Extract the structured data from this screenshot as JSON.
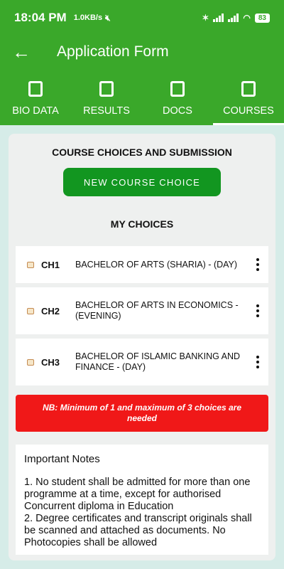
{
  "status_bar": {
    "time": "18:04 PM",
    "speed": "1.0KB/s",
    "battery": "83"
  },
  "app_bar": {
    "title": "Application Form"
  },
  "tabs": [
    {
      "label": "BIO DATA",
      "icon": "person-icon",
      "active": false
    },
    {
      "label": "RESULTS",
      "icon": "list-icon",
      "active": false
    },
    {
      "label": "DOCS",
      "icon": "clipboard-icon",
      "active": false
    },
    {
      "label": "COURSES",
      "icon": "checkbox-icon",
      "active": true
    }
  ],
  "main": {
    "section_title": "COURSE CHOICES AND SUBMISSION",
    "new_course_button": "NEW COURSE CHOICE",
    "my_choices_title": "MY CHOICES",
    "choices": [
      {
        "code": "CH1",
        "name": "BACHELOR OF ARTS (SHARIA) - (DAY)"
      },
      {
        "code": "CH2",
        "name": "BACHELOR OF ARTS IN ECONOMICS - (EVENING)"
      },
      {
        "code": "CH3",
        "name": "BACHELOR OF ISLAMIC BANKING AND FINANCE - (DAY)"
      }
    ],
    "nb_text": "NB: Minimum of 1 and maximum of 3 choices are needed",
    "notes_heading": "Important Notes",
    "notes_body_1": "1. No student shall be admitted for more than one programme at a time, except for authorised Concurrent diploma in Education",
    "notes_body_2": "2. Degree certificates and transcript originals shall be scanned and attached as documents. No Photocopies shall be allowed"
  },
  "colors": {
    "primary": "#3aa82a",
    "button": "#129620",
    "alert": "#f01818"
  }
}
